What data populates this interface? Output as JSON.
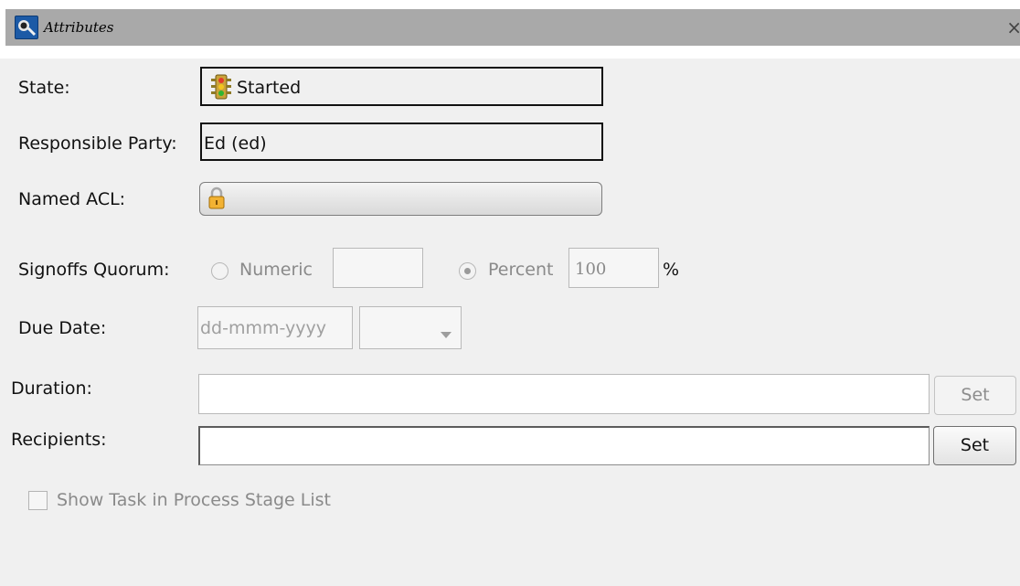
{
  "window": {
    "title": "Attributes",
    "close_glyph": "×"
  },
  "state": {
    "label": "State:",
    "value": "Started",
    "icon": "traffic-light-icon"
  },
  "responsible_party": {
    "label": "Responsible Party:",
    "value": "Ed (ed)"
  },
  "named_acl": {
    "label": "Named ACL:",
    "icon": "lock-icon"
  },
  "signoffs_quorum": {
    "label": "Signoffs Quorum:",
    "numeric_label": "Numeric",
    "numeric_value": "",
    "percent_label": "Percent",
    "percent_value": "100",
    "percent_sign": "%",
    "selected": "Percent"
  },
  "due_date": {
    "label": "Due Date:",
    "placeholder": "dd-mmm-yyyy",
    "time_value": ""
  },
  "duration": {
    "label": "Duration:",
    "value": "",
    "button": "Set"
  },
  "recipients": {
    "label": "Recipients:",
    "value": "",
    "button": "Set"
  },
  "show_task": {
    "label": "Show Task in Process Stage List",
    "checked": false
  }
}
